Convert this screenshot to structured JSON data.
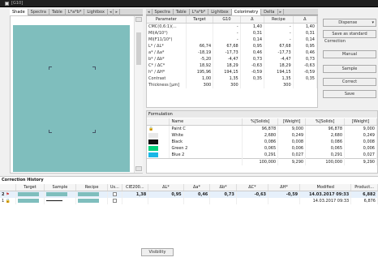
{
  "window": {
    "title": "[G10]"
  },
  "left_tabs": [
    "Shade",
    "Spectra",
    "Table",
    "L*a*b*",
    "Lightbox"
  ],
  "center_tabs": [
    "Spectra",
    "Table",
    "L*a*b*",
    "Lightbox",
    "Colorimetry",
    "Delta"
  ],
  "color_table": {
    "headers": [
      "Parameter",
      "Target",
      "G10",
      "Δ",
      "Recipe",
      "Δ"
    ],
    "rows": [
      [
        "CMC(0,6:1)(...",
        "",
        "-",
        "1,40",
        "-",
        "1,40"
      ],
      [
        "MI(A/10°)",
        "",
        "-",
        "0,31",
        "-",
        "0,31"
      ],
      [
        "MI(F11/10°)",
        "",
        "-",
        "0,14",
        "-",
        "0,14"
      ],
      [
        "L* / ΔL*",
        "66,74",
        "67,68",
        "0,95",
        "67,68",
        "0,95"
      ],
      [
        "a* / Δa*",
        "-18,19",
        "-17,73",
        "0,46",
        "-17,73",
        "0,46"
      ],
      [
        "b* / Δb*",
        "-5,20",
        "-4,47",
        "0,73",
        "-4,47",
        "0,73"
      ],
      [
        "C* / ΔC*",
        "18,92",
        "18,29",
        "-0,63",
        "18,29",
        "-0,63"
      ],
      [
        "h° / ΔH*",
        "195,96",
        "194,15",
        "-0,59",
        "194,15",
        "-0,59"
      ],
      [
        "Contrast",
        "1,00",
        "1,35",
        "0,35",
        "1,35",
        "0,35"
      ],
      [
        "Thickness [µm]",
        "300",
        "300",
        "",
        "300",
        ""
      ]
    ]
  },
  "right_panel": {
    "dispense": "Dispense",
    "save_standard": "Save as standard",
    "correction_label": "Correction",
    "manual": "Manual",
    "sample": "Sample",
    "correct": "Correct",
    "save": "Save"
  },
  "formulation": {
    "title": "Formulation",
    "headers": [
      "Name",
      "%[Solids]",
      "[Weight]",
      "%[Solids]",
      "[Weight]"
    ],
    "rows": [
      {
        "name": "Paint C",
        "s1": "96,878",
        "w1": "9,000",
        "s2": "96,878",
        "w2": "9,000",
        "color": ""
      },
      {
        "name": "White",
        "s1": "2,680",
        "w1": "0,249",
        "s2": "2,680",
        "w2": "0,249",
        "color": "#e8e8e8"
      },
      {
        "name": "Black",
        "s1": "0,086",
        "w1": "0,008",
        "s2": "0,086",
        "w2": "0,008",
        "color": "#111111"
      },
      {
        "name": "Green 2",
        "s1": "0,065",
        "w1": "0,006",
        "s2": "0,065",
        "w2": "0,006",
        "color": "#00d27c"
      },
      {
        "name": "Blue 2",
        "s1": "0,291",
        "w1": "0,027",
        "s2": "0,291",
        "w2": "0,027",
        "color": "#19b7e6"
      }
    ],
    "totals": {
      "s1": "100,000",
      "w1": "9,290",
      "s2": "100,000",
      "w2": "9,290"
    }
  },
  "history": {
    "title": "Correction History",
    "headers": [
      "",
      "Target",
      "Sample",
      "Recipe",
      "Us...",
      "CIE200...",
      "ΔL*",
      "Δa*",
      "Δb*",
      "ΔC*",
      "ΔH*",
      "Modified",
      "Product..."
    ],
    "rows": [
      {
        "n": "2",
        "cie": "1,38",
        "dl": "0,95",
        "da": "0,46",
        "db": "0,73",
        "dc": "-0,63",
        "dh": "-0,59",
        "mod": "14.03.2017 09:33",
        "prod": "6,882"
      },
      {
        "n": "1",
        "cie": "",
        "dl": "",
        "da": "",
        "db": "",
        "dc": "",
        "dh": "",
        "mod": "14.03.2017 09:33",
        "prod": "6,876"
      }
    ]
  },
  "visibility_label": "Visibility"
}
